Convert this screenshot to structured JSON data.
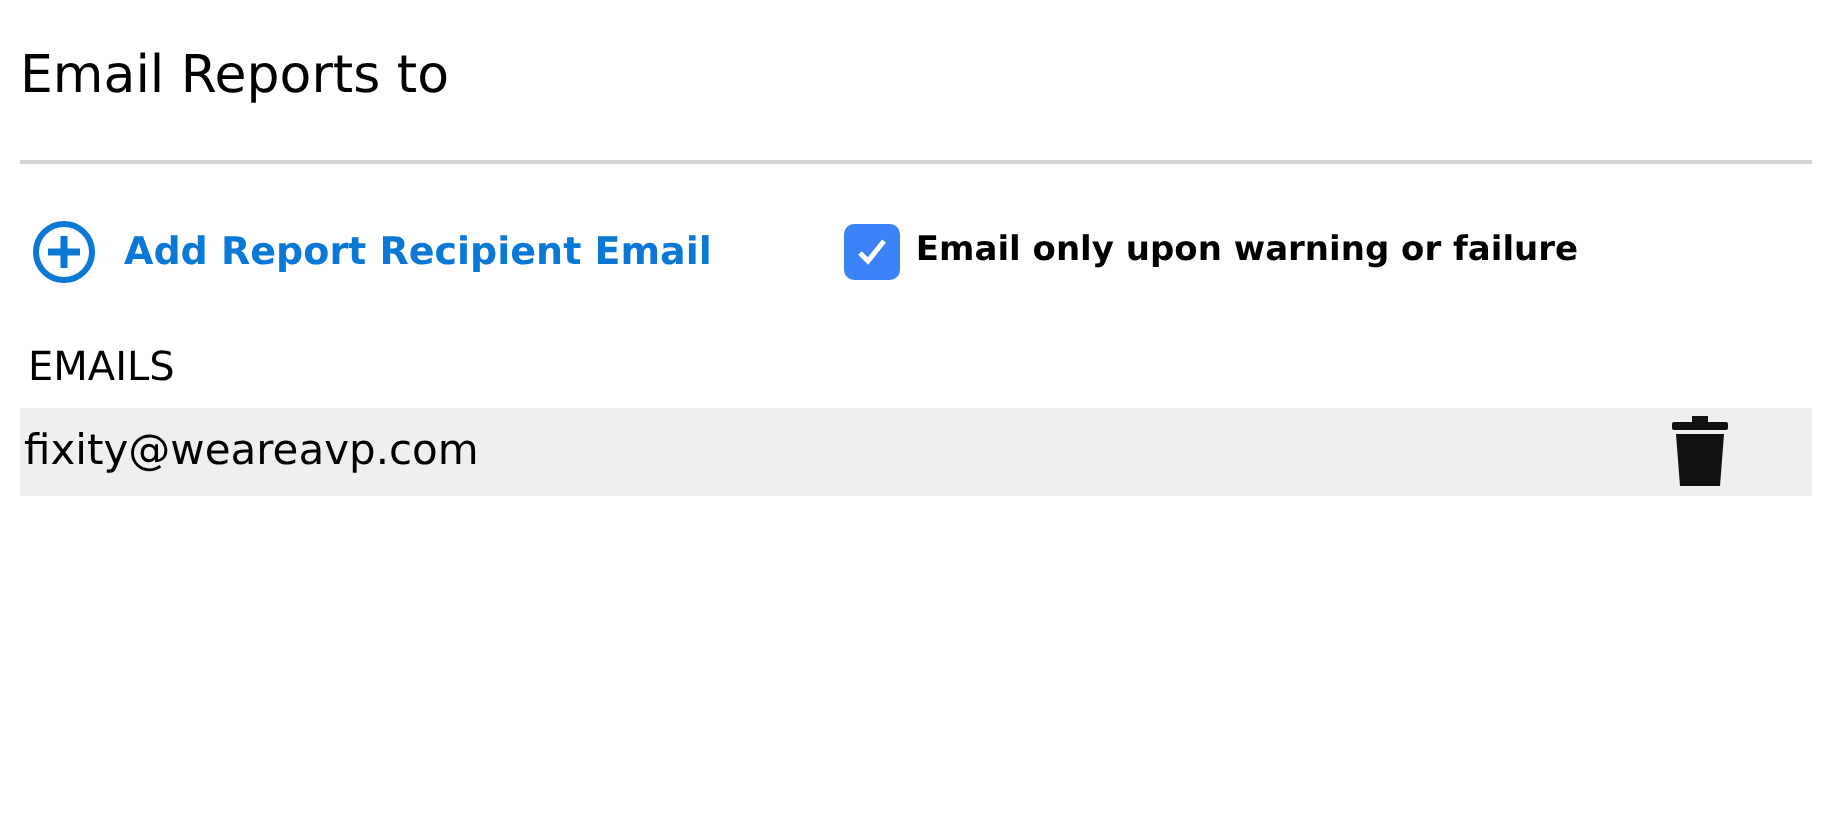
{
  "title": "Email Reports to",
  "add_link": {
    "label": "Add Report Recipient Email"
  },
  "warning_only": {
    "label": "Email only upon warning or failure",
    "checked": true
  },
  "emails": {
    "heading": "EMAILS",
    "rows": [
      {
        "address": "fixity@weareavp.com"
      }
    ]
  }
}
